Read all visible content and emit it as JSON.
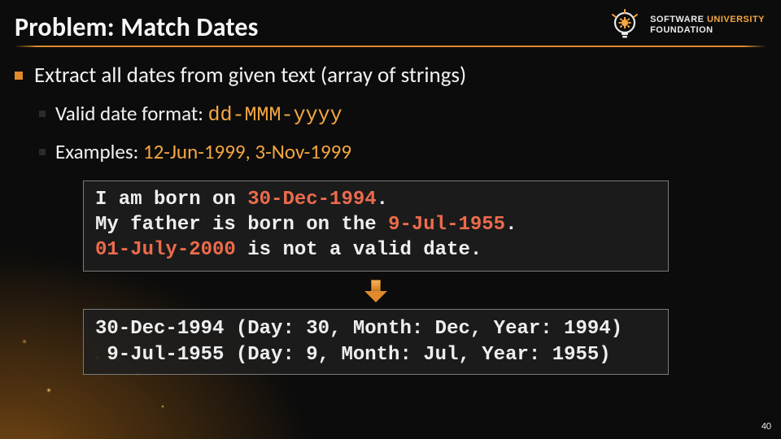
{
  "title": "Problem: Match Dates",
  "bullets": {
    "main": "Extract all dates from given text (array of strings)",
    "format_label": "Valid date format: ",
    "format_value": "dd-MMM-yyyy",
    "examples_label": "Examples: ",
    "examples_value": "12-Jun-1999, 3-Nov-1999"
  },
  "code": {
    "seg1": "I am born on ",
    "date1": "30-Dec-1994",
    "seg2": ".\nMy father is born on the ",
    "date2": "9-Jul-1955",
    "seg3": ".\n",
    "bad": "01-July-2000",
    "seg4": " is not a valid date."
  },
  "output": {
    "line1": "30-Dec-1994 (Day: 30, Month: Dec, Year: 1994)",
    "line2": " 9-Jul-1955 (Day: 9, Month: Jul, Year: 1955)"
  },
  "logo": {
    "word1": "SOFTWARE",
    "word2": "UNIVERSITY",
    "word3": "FOUNDATION"
  },
  "page_number": "40",
  "colors": {
    "accent": "#e08a2c",
    "highlight": "#ec6b4c",
    "background": "#0c0c0c"
  }
}
